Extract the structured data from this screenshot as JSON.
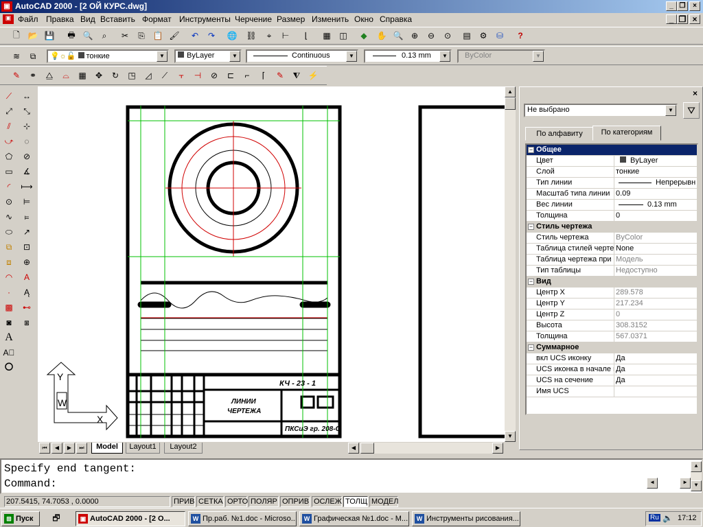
{
  "window": {
    "title": "AutoCAD 2000 - [2 ОЙ КУРС.dwg]"
  },
  "menu": [
    "Файл",
    "Правка",
    "Вид",
    "Вставить",
    "Формат",
    "Инструменты",
    "Черчение",
    "Размер",
    "Изменить",
    "Окно",
    "Справка"
  ],
  "layer_toolbar": {
    "layer": "тонкие",
    "color": "ByLayer",
    "linetype": "Continuous",
    "lineweight": "0.13 mm",
    "plotstyle": "ByColor"
  },
  "drawing": {
    "code": "КЧ - 23 - 1",
    "title_line1": "ЛИНИИ",
    "title_line2": "ЧЕРТЕЖА",
    "org": "ПКСиЭ гр. 208-С"
  },
  "layout_tabs": [
    "Model",
    "Layout1",
    "Layout2"
  ],
  "properties": {
    "selection": "Не выбрано",
    "tabs": [
      "По алфавиту",
      "По категориям"
    ],
    "rows": [
      {
        "type": "cat",
        "k": "Общее",
        "sel": true
      },
      {
        "k": "Цвет",
        "v": "ByLayer"
      },
      {
        "k": "Слой",
        "v": "тонкие"
      },
      {
        "k": "Тип линии",
        "v": "Непрерывн"
      },
      {
        "k": "Масштаб типа линии",
        "v": "0.09"
      },
      {
        "k": "Вес линии",
        "v": "0.13 mm"
      },
      {
        "k": "Толщина",
        "v": "0"
      },
      {
        "type": "cat",
        "k": "Стиль чертежа"
      },
      {
        "k": "Стиль чертежа",
        "v": "ByColor",
        "gray": true
      },
      {
        "k": "Таблица стилей черте",
        "v": "None"
      },
      {
        "k": "Таблица чертежа при",
        "v": "Модель",
        "gray": true
      },
      {
        "k": "Тип таблицы",
        "v": "Недоступно",
        "gray": true
      },
      {
        "type": "cat",
        "k": "Вид"
      },
      {
        "k": "Центр X",
        "v": "289.578",
        "gray": true
      },
      {
        "k": "Центр Y",
        "v": "217.234",
        "gray": true
      },
      {
        "k": "Центр Z",
        "v": "0",
        "gray": true
      },
      {
        "k": "Высота",
        "v": "308.3152",
        "gray": true
      },
      {
        "k": "Толщина",
        "v": "567.0371",
        "gray": true
      },
      {
        "type": "cat",
        "k": "Суммарное"
      },
      {
        "k": "вкл UCS иконку",
        "v": "Да"
      },
      {
        "k": "UCS иконка в начале к",
        "v": "Да"
      },
      {
        "k": "UCS на сечение",
        "v": "Да"
      },
      {
        "k": "Имя UCS",
        "v": ""
      }
    ]
  },
  "command": {
    "line1": "Specify end tangent:",
    "line2": "Command:"
  },
  "status": {
    "coords": "207.5415, 74.7053 , 0.0000",
    "toggles": [
      "ПРИВ",
      "СЕТКА",
      "ОРТО",
      "ПОЛЯР",
      "ОПРИВ",
      "ОСЛЕЖ",
      "ТОЛЩ",
      "МОДЕЛ"
    ]
  },
  "taskbar": {
    "start": "Пуск",
    "tasks": [
      "AutoCAD 2000 - [2 О...",
      "Пр.раб. №1.doc - Microso...",
      "Графическая №1.doc - M...",
      "Инструменты рисования..."
    ],
    "lang": "Ru",
    "clock": "17:12"
  },
  "ucs": {
    "x": "X",
    "y": "Y",
    "w": "W"
  }
}
